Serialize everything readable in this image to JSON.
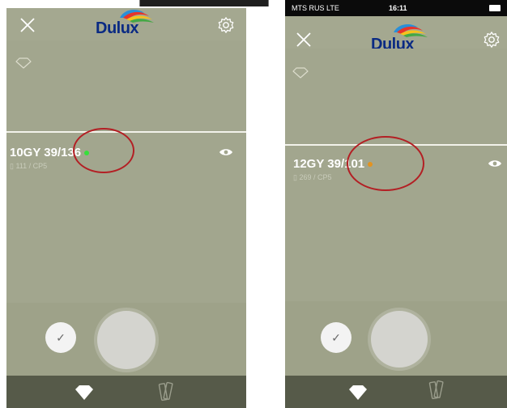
{
  "left_screen": {
    "brand": "Dulux",
    "color_code": "10GY 39/136",
    "reference": "111 / CP5",
    "dot_color": "#37e03b"
  },
  "right_screen": {
    "status": {
      "carrier": "MTS RUS  LTE",
      "time": "16:11"
    },
    "brand": "Dulux",
    "color_code": "12GY 39/101",
    "reference": "269 / CP5",
    "dot_color": "#e39320"
  },
  "colors": {
    "highlight": "#b31f24"
  }
}
